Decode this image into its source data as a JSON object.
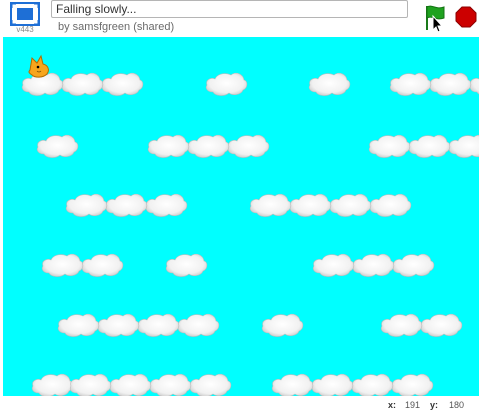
{
  "header": {
    "version_label": "v443",
    "project_title": "Falling slowly...",
    "byline": "by samsfgreen (shared)"
  },
  "controls": {
    "flag_icon": "green-flag-icon",
    "stop_icon": "stop-sign-icon",
    "flag_color": "#1fa21f",
    "stop_color": "#cc0000"
  },
  "stage": {
    "background_color": "#00ffff",
    "sprite": "cat-sprite",
    "cloud_sprite": "cloud-sprite"
  },
  "status": {
    "x_label": "x:",
    "x_value": "191",
    "y_label": "y:",
    "y_value": "180"
  }
}
